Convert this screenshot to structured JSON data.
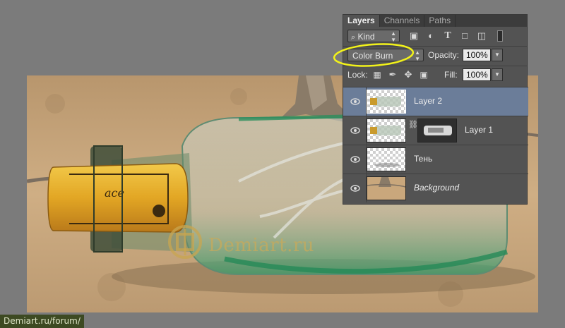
{
  "panel": {
    "tabs": [
      {
        "label": "Layers",
        "active": true
      },
      {
        "label": "Channels",
        "active": false
      },
      {
        "label": "Paths",
        "active": false
      }
    ],
    "filter": {
      "kind_label": "Kind"
    },
    "blend_mode": "Color Burn",
    "opacity_label": "Opacity:",
    "opacity_value": "100%",
    "lock_label": "Lock:",
    "fill_label": "Fill:",
    "fill_value": "100%",
    "layers": [
      {
        "name": "Layer 2",
        "selected": true,
        "italic": false,
        "has_mask": false
      },
      {
        "name": "Layer 1",
        "selected": false,
        "italic": false,
        "has_mask": true
      },
      {
        "name": "Тень",
        "selected": false,
        "italic": false,
        "has_mask": false
      },
      {
        "name": "Background",
        "selected": false,
        "italic": true,
        "has_mask": false
      }
    ]
  },
  "watermark": {
    "text": "Demiart.ru"
  },
  "footer": {
    "url": "Demiart.ru/forum/"
  },
  "colors": {
    "panel_bg": "#535353",
    "selected_layer": "#6b7d99",
    "highlight_ellipse": "#f2f21a",
    "canvas_bg": "#7b7b7b",
    "sand": "#c9a77c",
    "bottle_green": "#2e8a5a",
    "cork": "#e0a92a"
  },
  "icons": {
    "search": "search-icon",
    "visibility": "eye-icon",
    "link": "chain-link-icon"
  }
}
